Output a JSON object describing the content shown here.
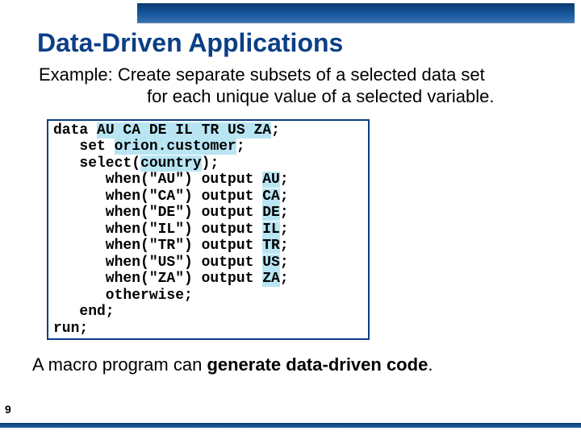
{
  "title": "Data-Driven Applications",
  "example": {
    "label": "Example:  ",
    "line1": "Create separate subsets of a selected data set",
    "line2": "for each unique value of a selected variable."
  },
  "code": {
    "l1a": "data ",
    "l1b": "AU CA DE IL TR US ZA",
    "l1c": ";",
    "l2a": "   set ",
    "l2b": "orion.customer",
    "l2c": ";",
    "l3a": "   select(",
    "l3b": "country",
    "l3c": ");",
    "w_au_a": "      when(\"AU\") output ",
    "w_au_b": "AU",
    "w_au_c": ";",
    "w_ca_a": "      when(\"CA\") output ",
    "w_ca_b": "CA",
    "w_ca_c": ";",
    "w_de_a": "      when(\"DE\") output ",
    "w_de_b": "DE",
    "w_de_c": ";",
    "w_il_a": "      when(\"IL\") output ",
    "w_il_b": "IL",
    "w_il_c": ";",
    "w_tr_a": "      when(\"TR\") output ",
    "w_tr_b": "TR",
    "w_tr_c": ";",
    "w_us_a": "      when(\"US\") output ",
    "w_us_b": "US",
    "w_us_c": ";",
    "w_za_a": "      when(\"ZA\") output ",
    "w_za_b": "ZA",
    "w_za_c": ";",
    "other": "      otherwise;",
    "end": "   end;",
    "run": "run;"
  },
  "footer": {
    "part1": "A macro program can ",
    "part2": "generate data-driven code",
    "part3": "."
  },
  "page_number": "9"
}
